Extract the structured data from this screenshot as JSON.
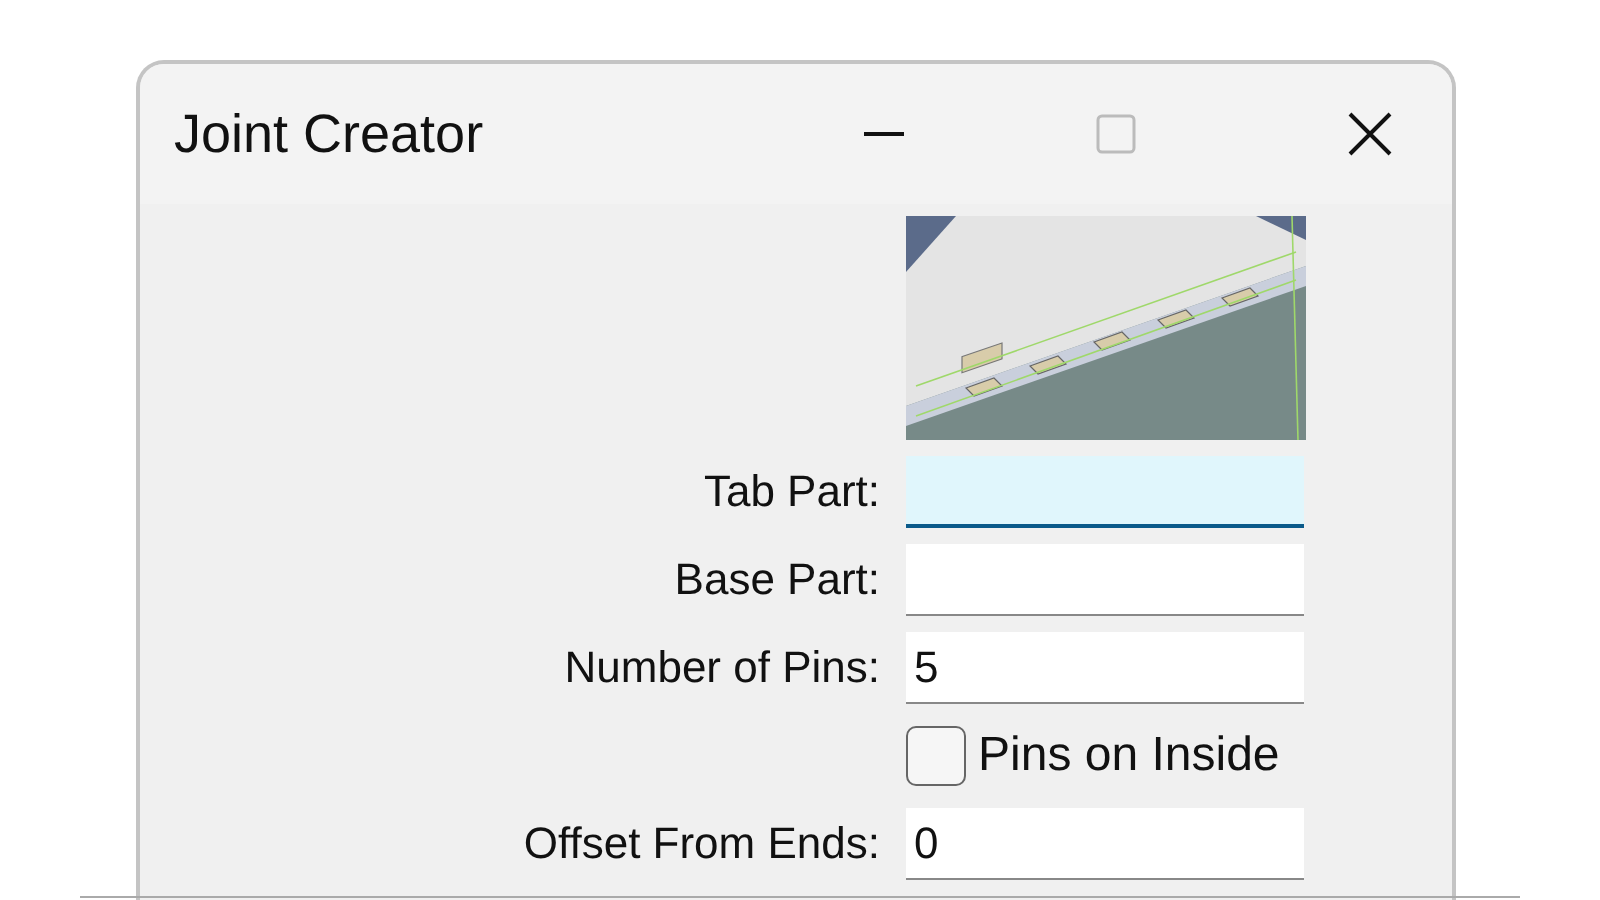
{
  "window": {
    "title": "Joint Creator"
  },
  "fields": [
    {
      "kind": "text",
      "label": "Tab Part:",
      "focused": true
    },
    {
      "kind": "text",
      "label": "Base Part:",
      "focused": false
    },
    {
      "kind": "text",
      "label": "Number of Pins:",
      "value": "5",
      "focused": false
    },
    {
      "kind": "checkbox",
      "label": "Pins on Inside",
      "checked": false
    },
    {
      "kind": "text",
      "label": "Offset From Ends:",
      "value": "0",
      "focused": false
    }
  ]
}
